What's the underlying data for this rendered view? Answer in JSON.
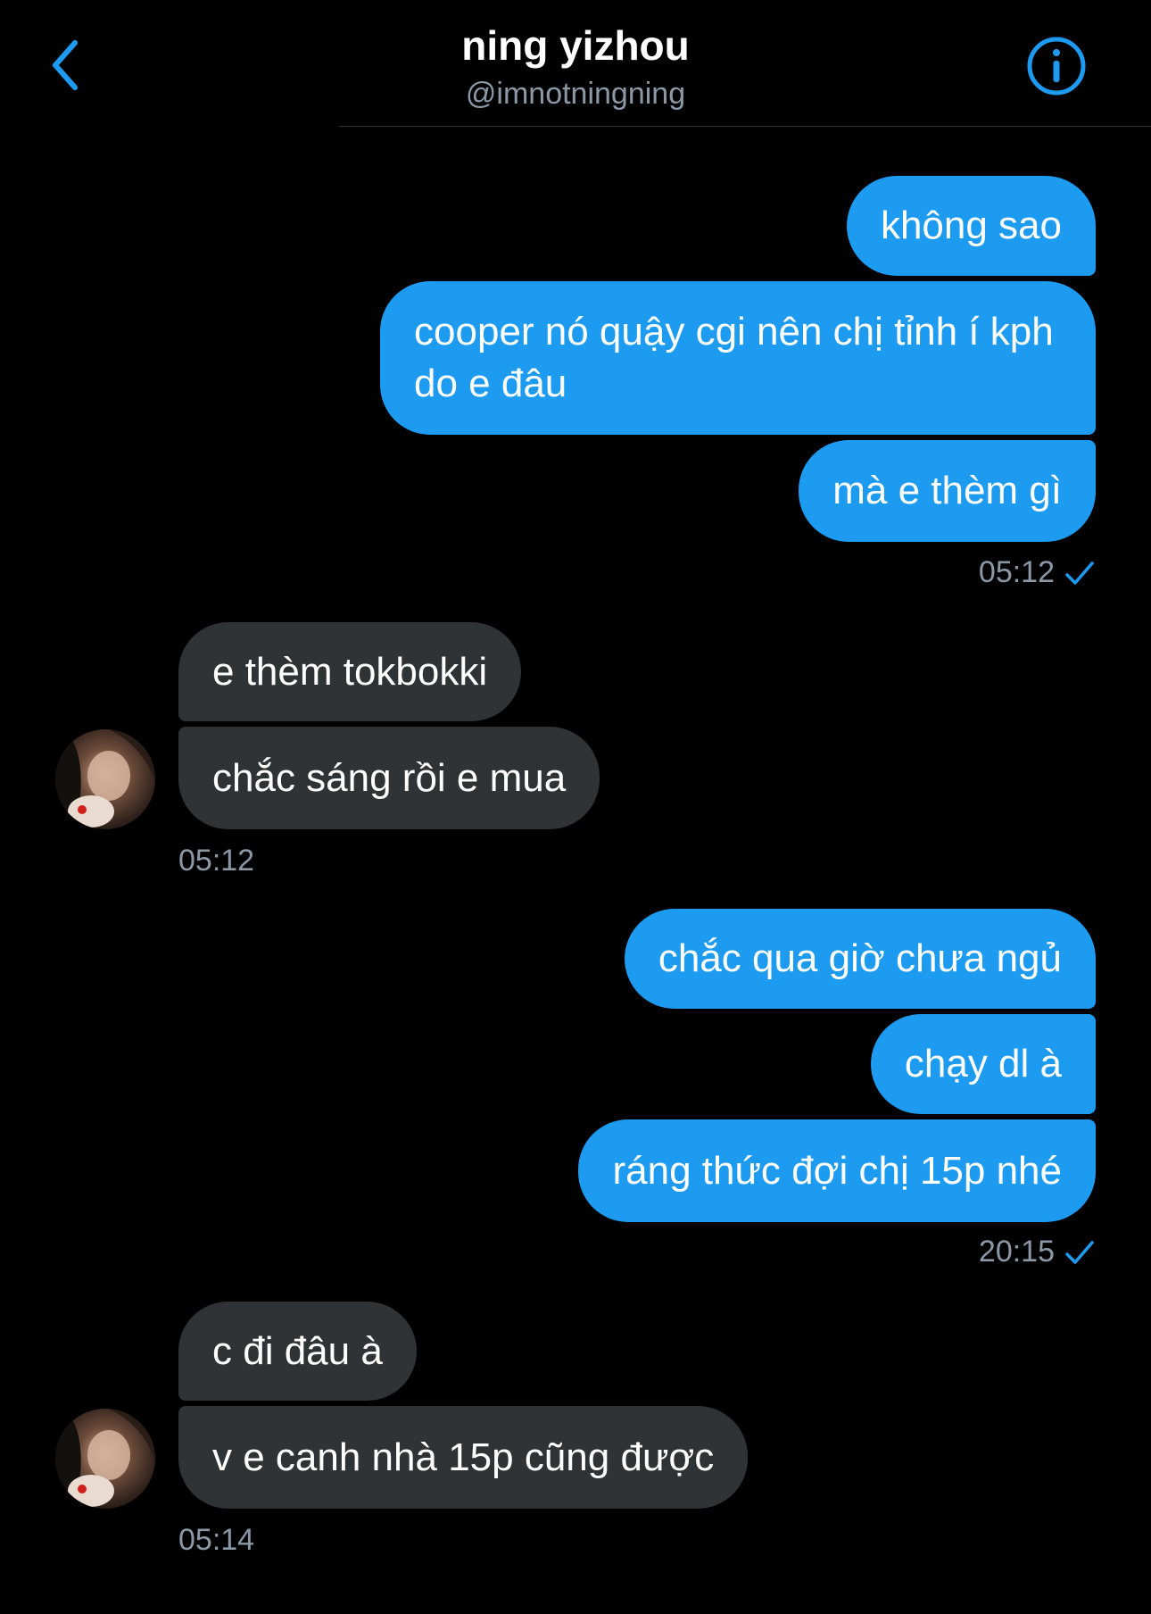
{
  "header": {
    "name": "ning yizhou",
    "handle": "@imnotningning",
    "back_icon": "chevron-left-icon",
    "info_icon": "info-circle-icon",
    "accent": "#1d9bf0"
  },
  "messages": [
    {
      "dir": "out",
      "text": "không sao"
    },
    {
      "dir": "out",
      "text": "cooper nó quậy cgi nên chị tỉnh í kph do e đâu"
    },
    {
      "dir": "out",
      "text": "mà e thèm gì"
    },
    {
      "dir": "meta",
      "time": "05:12",
      "read": true
    },
    {
      "dir": "in",
      "text": "e thèm tokbokki"
    },
    {
      "dir": "in",
      "text": "chắc sáng rồi e mua"
    },
    {
      "dir": "meta",
      "time": "05:12"
    },
    {
      "dir": "out",
      "text": "chắc qua giờ chưa ngủ"
    },
    {
      "dir": "out",
      "text": "chạy dl à"
    },
    {
      "dir": "out",
      "text": "ráng thức đợi chị 15p nhé"
    },
    {
      "dir": "meta",
      "time": "20:15",
      "read": true
    },
    {
      "dir": "in",
      "text": "c đi đâu à"
    },
    {
      "dir": "in",
      "text": "v e canh nhà 15p cũng được"
    },
    {
      "dir": "meta",
      "time": "05:14"
    }
  ],
  "colors": {
    "outgoing": "#1d9bf0",
    "incoming": "#2f3336",
    "meta_text": "#8b98a5"
  }
}
